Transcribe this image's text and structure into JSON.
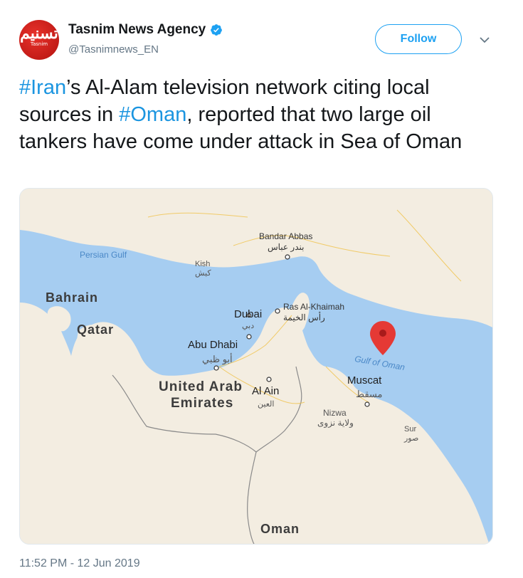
{
  "account": {
    "name": "Tasnim News Agency",
    "handle": "@Tasnimnews_EN",
    "avatar_text": "Tasnim",
    "avatar_glyph": "تسنیم",
    "follow_label": "Follow"
  },
  "tweet": {
    "part1_tag": "#Iran",
    "part2": "’s Al-Alam television network citing local sources in ",
    "part3_tag": "#Oman",
    "part4": ", reported that two large oil tankers have come under attack in Sea of Oman"
  },
  "map": {
    "labels": {
      "persian_gulf": "Persian Gulf",
      "bandar_abbas": "Bandar Abbas",
      "bandar_abbas_ar": "بندر عباس",
      "kish": "Kish",
      "kish_ar": "کیش",
      "bahrain": "Bahrain",
      "qatar": "Qatar",
      "ras_al_khaimah": "Ras Al-Khaimah",
      "ras_al_khaimah_ar": "رأس الخيمة",
      "dubai": "Dubai",
      "dubai_ar": "دبي",
      "abu_dhabi": "Abu Dhabi",
      "abu_dhabi_ar": "أبو ظبي",
      "uae_line1": "United Arab",
      "uae_line2": "Emirates",
      "al_ain": "Al Ain",
      "al_ain_ar": "العين",
      "gulf_of_oman": "Gulf of Oman",
      "muscat": "Muscat",
      "muscat_ar": "مسقط",
      "nizwa": "Nizwa",
      "nizwa_ar": "ولاية نزوى",
      "sur": "Sur",
      "sur_ar": "صور",
      "oman": "Oman"
    },
    "colors": {
      "water": "#a6cdf1",
      "land": "#f3ede1",
      "pin": "#e53935"
    }
  },
  "timestamp": "11:52 PM - 12 Jun 2019"
}
